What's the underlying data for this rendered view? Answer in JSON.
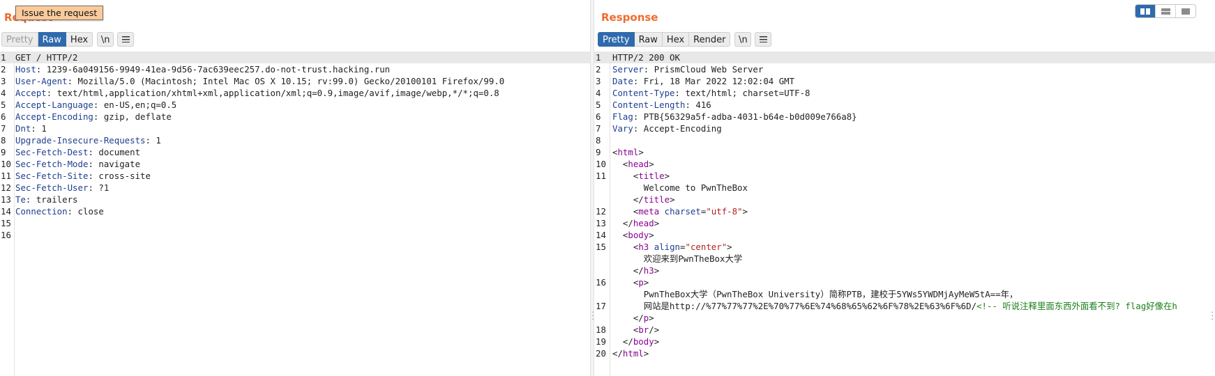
{
  "tooltip": "Issue the request",
  "request": {
    "title": "Request",
    "tabs": {
      "pretty": "Pretty",
      "raw": "Raw",
      "hex": "Hex",
      "newline": "\\n"
    },
    "lines": [
      {
        "n": "1",
        "key": "",
        "val": "GET / HTTP/2"
      },
      {
        "n": "2",
        "key": "Host",
        "val": "1239-6a049156-9949-41ea-9d56-7ac639eec257.do-not-trust.hacking.run"
      },
      {
        "n": "3",
        "key": "User-Agent",
        "val": "Mozilla/5.0 (Macintosh; Intel Mac OS X 10.15; rv:99.0) Gecko/20100101 Firefox/99.0"
      },
      {
        "n": "4",
        "key": "Accept",
        "val": "text/html,application/xhtml+xml,application/xml;q=0.9,image/avif,image/webp,*/*;q=0.8"
      },
      {
        "n": "5",
        "key": "Accept-Language",
        "val": "en-US,en;q=0.5"
      },
      {
        "n": "6",
        "key": "Accept-Encoding",
        "val": "gzip, deflate"
      },
      {
        "n": "7",
        "key": "Dnt",
        "val": "1"
      },
      {
        "n": "8",
        "key": "Upgrade-Insecure-Requests",
        "val": "1"
      },
      {
        "n": "9",
        "key": "Sec-Fetch-Dest",
        "val": "document"
      },
      {
        "n": "10",
        "key": "Sec-Fetch-Mode",
        "val": "navigate"
      },
      {
        "n": "11",
        "key": "Sec-Fetch-Site",
        "val": "cross-site"
      },
      {
        "n": "12",
        "key": "Sec-Fetch-User",
        "val": "?1"
      },
      {
        "n": "13",
        "key": "Te",
        "val": "trailers"
      },
      {
        "n": "14",
        "key": "Connection",
        "val": "close"
      },
      {
        "n": "15",
        "key": "",
        "val": ""
      },
      {
        "n": "16",
        "key": "",
        "val": ""
      }
    ]
  },
  "response": {
    "title": "Response",
    "tabs": {
      "pretty": "Pretty",
      "raw": "Raw",
      "hex": "Hex",
      "render": "Render",
      "newline": "\\n"
    },
    "headers": [
      {
        "n": "1",
        "key": "",
        "val": "HTTP/2 200 OK"
      },
      {
        "n": "2",
        "key": "Server",
        "val": "PrismCloud Web Server"
      },
      {
        "n": "3",
        "key": "Date",
        "val": "Fri, 18 Mar 2022 12:02:04 GMT"
      },
      {
        "n": "4",
        "key": "Content-Type",
        "val": "text/html; charset=UTF-8"
      },
      {
        "n": "5",
        "key": "Content-Length",
        "val": "416"
      },
      {
        "n": "6",
        "key": "Flag",
        "val": "PTB{56329a5f-adba-4031-b64e-b0d009e766a8}"
      },
      {
        "n": "7",
        "key": "Vary",
        "val": "Accept-Encoding"
      },
      {
        "n": "8",
        "key": "",
        "val": ""
      }
    ],
    "body": {
      "html_tag": "html",
      "head_tag": "head",
      "title_tag": "title",
      "title_text": "Welcome to PwnTheBox",
      "meta_tag": "meta",
      "meta_attr": "charset",
      "meta_value": "\"utf-8\"",
      "body_tag": "body",
      "h3_tag": "h3",
      "h3_attr": "align",
      "h3_value": "\"center\"",
      "h3_text": "欢迎来到PwnTheBox大学",
      "p_tag": "p",
      "p_line1": "PwnTheBox大学（PwnTheBox University）简称PTB，建校于5YWs5YWDMjAyMeW5tA==年，",
      "p_line2_text": "网站是http://%77%77%77%2E%70%77%6E%74%68%65%62%6F%78%2E%63%6F%6D/",
      "p_line2_comment": "<!-- 听说注释里面东西外面看不到? flag好像在h",
      "br_tag": "br",
      "line_numbers": [
        "9",
        "10",
        "11",
        "12",
        "13",
        "14",
        "15",
        "16",
        "17",
        "18",
        "19",
        "20"
      ]
    }
  },
  "layout_buttons": [
    "split-horizontal",
    "split-vertical",
    "single-pane"
  ]
}
